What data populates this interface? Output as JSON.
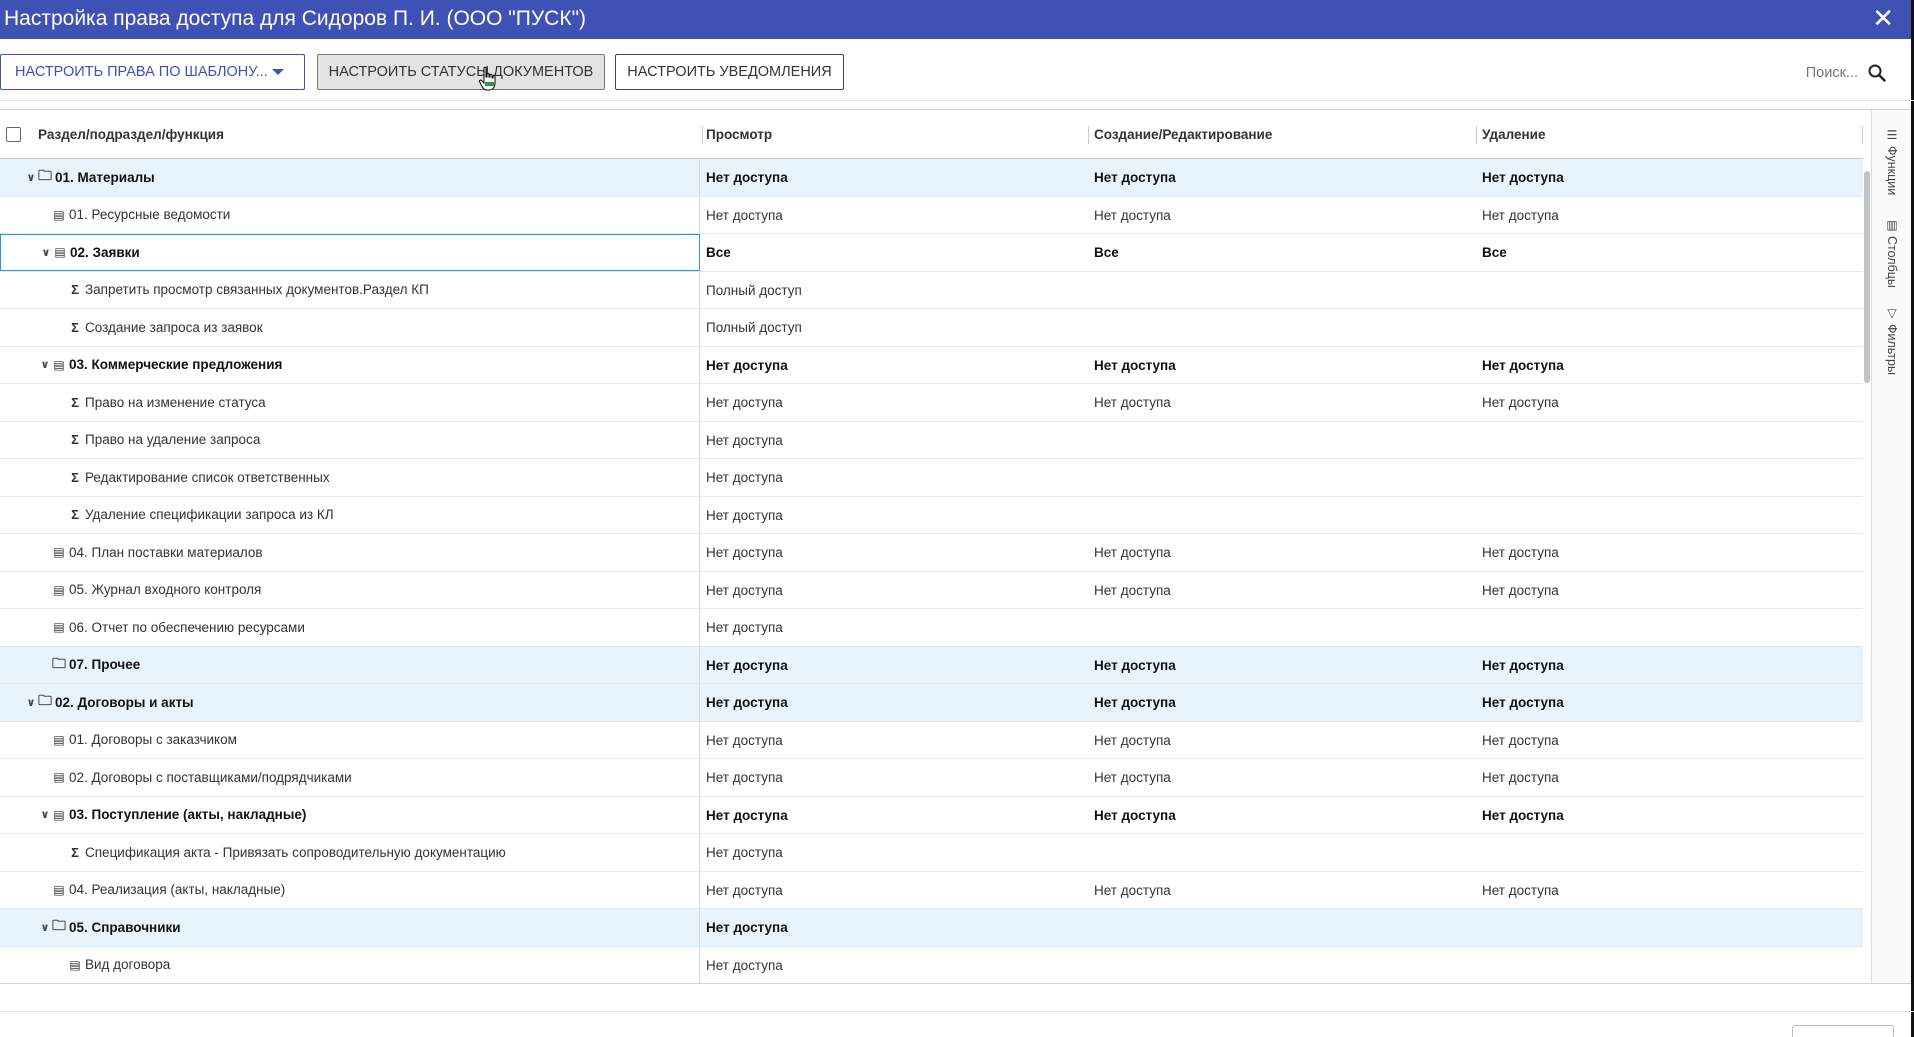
{
  "dialog": {
    "title": "Настройка права доступа для Сидоров П. И. (ООО \"ПУСК\")",
    "close_glyph": "✕",
    "header_color": "#3f51b5"
  },
  "toolbar": {
    "template_label": "НАСТРОИТЬ ПРАВА ПО ШАБЛОНУ...",
    "statuses_label": "НАСТРОИТЬ СТАТУСЫ ДОКУМЕНТОВ",
    "notifications_label": "НАСТРОИТЬ УВЕДОМЛЕНИЯ",
    "search_placeholder": "Поиск..."
  },
  "grid": {
    "columns": [
      "Раздел/подраздел/функция",
      "Просмотр",
      "Создание/Редактирование",
      "Удаление"
    ],
    "rows": [
      {
        "level": 0,
        "expander": "open",
        "icon": "folder",
        "name": "01. Материалы",
        "view": "Нет доступа",
        "edit": "Нет доступа",
        "delete": "Нет доступа",
        "bold": true,
        "highlight": true
      },
      {
        "level": 1,
        "expander": "",
        "icon": "table",
        "name": "01. Ресурсные ведомости",
        "view": "Нет доступа",
        "edit": "Нет доступа",
        "delete": "Нет доступа",
        "bold": false,
        "highlight": false
      },
      {
        "level": 1,
        "expander": "open",
        "icon": "table",
        "name": "02. Заявки",
        "view": "Все",
        "edit": "Все",
        "delete": "Все",
        "bold": true,
        "highlight": false,
        "focused": true
      },
      {
        "level": 2,
        "expander": "",
        "icon": "sigma",
        "name": "Запретить просмотр связанных документов.Раздел КП",
        "view": "Полный доступ",
        "edit": "",
        "delete": "",
        "bold": false,
        "highlight": false
      },
      {
        "level": 2,
        "expander": "",
        "icon": "sigma",
        "name": "Создание запроса из заявок",
        "view": "Полный доступ",
        "edit": "",
        "delete": "",
        "bold": false,
        "highlight": false
      },
      {
        "level": 1,
        "expander": "open",
        "icon": "table",
        "name": "03. Коммерческие предложения",
        "view": "Нет доступа",
        "edit": "Нет доступа",
        "delete": "Нет доступа",
        "bold": true,
        "highlight": false
      },
      {
        "level": 2,
        "expander": "",
        "icon": "sigma",
        "name": "Право на изменение статуса",
        "view": "Нет доступа",
        "edit": "Нет доступа",
        "delete": "Нет доступа",
        "bold": false,
        "highlight": false
      },
      {
        "level": 2,
        "expander": "",
        "icon": "sigma",
        "name": "Право на удаление запроса",
        "view": "Нет доступа",
        "edit": "",
        "delete": "",
        "bold": false,
        "highlight": false
      },
      {
        "level": 2,
        "expander": "",
        "icon": "sigma",
        "name": "Редактирование список ответственных",
        "view": "Нет доступа",
        "edit": "",
        "delete": "",
        "bold": false,
        "highlight": false
      },
      {
        "level": 2,
        "expander": "",
        "icon": "sigma",
        "name": "Удаление спецификации запроса из КЛ",
        "view": "Нет доступа",
        "edit": "",
        "delete": "",
        "bold": false,
        "highlight": false
      },
      {
        "level": 1,
        "expander": "",
        "icon": "table",
        "name": "04. План поставки материалов",
        "view": "Нет доступа",
        "edit": "Нет доступа",
        "delete": "Нет доступа",
        "bold": false,
        "highlight": false
      },
      {
        "level": 1,
        "expander": "",
        "icon": "table",
        "name": "05. Журнал входного контроля",
        "view": "Нет доступа",
        "edit": "Нет доступа",
        "delete": "Нет доступа",
        "bold": false,
        "highlight": false
      },
      {
        "level": 1,
        "expander": "",
        "icon": "table",
        "name": "06. Отчет по обеспечению ресурсами",
        "view": "Нет доступа",
        "edit": "",
        "delete": "",
        "bold": false,
        "highlight": false
      },
      {
        "level": 1,
        "expander": "",
        "icon": "folder",
        "name": "07. Прочее",
        "view": "Нет доступа",
        "edit": "Нет доступа",
        "delete": "Нет доступа",
        "bold": true,
        "highlight": true
      },
      {
        "level": 0,
        "expander": "open",
        "icon": "folder",
        "name": "02. Договоры и акты",
        "view": "Нет доступа",
        "edit": "Нет доступа",
        "delete": "Нет доступа",
        "bold": true,
        "highlight": true
      },
      {
        "level": 1,
        "expander": "",
        "icon": "table",
        "name": "01. Договоры с заказчиком",
        "view": "Нет доступа",
        "edit": "Нет доступа",
        "delete": "Нет доступа",
        "bold": false,
        "highlight": false
      },
      {
        "level": 1,
        "expander": "",
        "icon": "table",
        "name": "02. Договоры с поставщиками/подрядчиками",
        "view": "Нет доступа",
        "edit": "Нет доступа",
        "delete": "Нет доступа",
        "bold": false,
        "highlight": false
      },
      {
        "level": 1,
        "expander": "open",
        "icon": "table",
        "name": "03. Поступление (акты, накладные)",
        "view": "Нет доступа",
        "edit": "Нет доступа",
        "delete": "Нет доступа",
        "bold": true,
        "highlight": false
      },
      {
        "level": 2,
        "expander": "",
        "icon": "sigma",
        "name": "Спецификация акта - Привязать сопроводительную документацию",
        "view": "Нет доступа",
        "edit": "",
        "delete": "",
        "bold": false,
        "highlight": false
      },
      {
        "level": 1,
        "expander": "",
        "icon": "table",
        "name": "04. Реализация (акты, накладные)",
        "view": "Нет доступа",
        "edit": "Нет доступа",
        "delete": "Нет доступа",
        "bold": false,
        "highlight": false
      },
      {
        "level": 1,
        "expander": "open",
        "icon": "folder",
        "name": "05. Справочники",
        "view": "Нет доступа",
        "edit": "",
        "delete": "",
        "bold": true,
        "highlight": true
      },
      {
        "level": 2,
        "expander": "",
        "icon": "table",
        "name": "Вид договора",
        "view": "Нет доступа",
        "edit": "",
        "delete": "",
        "bold": false,
        "highlight": false
      }
    ]
  },
  "side_panel": {
    "tabs": [
      {
        "icon": "☰",
        "label": "Функции"
      },
      {
        "icon": "▥",
        "label": "Столбцы"
      },
      {
        "icon": "▽",
        "label": "Фильтры"
      }
    ]
  }
}
